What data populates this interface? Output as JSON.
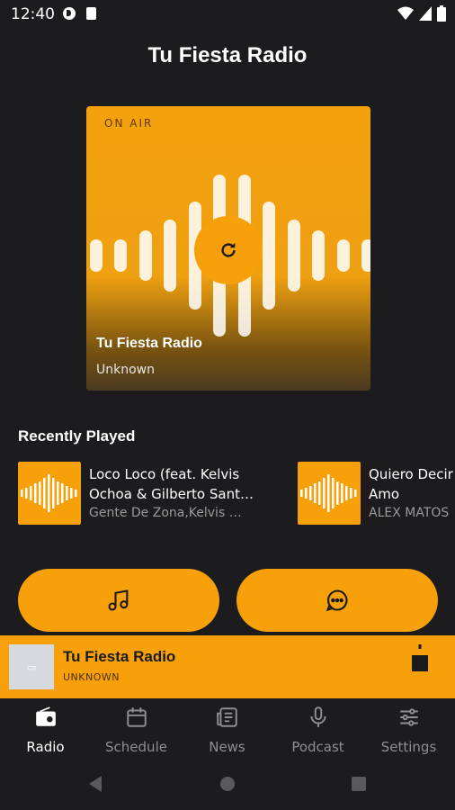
{
  "status_bar": {
    "time": "12:40"
  },
  "app": {
    "title": "Tu Fiesta Radio"
  },
  "now_playing": {
    "badge": "ON AIR",
    "station": "Tu Fiesta Radio",
    "artist": "Unknown"
  },
  "recent": {
    "heading": "Recently Played",
    "items": [
      {
        "title_line1": "Loco Loco (feat. Kelvis",
        "title_line2": "Ochoa & Gilberto Sant…",
        "artist": "Gente De Zona,Kelvis …"
      },
      {
        "title_line1": "Quiero Decir",
        "title_line2": "Amo",
        "artist": "ALEX MATOS"
      }
    ]
  },
  "actions": {
    "left_icon": "music-note-icon",
    "right_icon": "chat-bubble-icon"
  },
  "mini_player": {
    "title": "Tu Fiesta Radio",
    "subtitle": "UNKNOWN",
    "thumb_text": "▭"
  },
  "nav": {
    "items": [
      {
        "label": "Radio",
        "icon": "radio-icon",
        "active": true
      },
      {
        "label": "Schedule",
        "icon": "calendar-icon"
      },
      {
        "label": "News",
        "icon": "newspaper-icon"
      },
      {
        "label": "Podcast",
        "icon": "microphone-icon"
      },
      {
        "label": "Settings",
        "icon": "sliders-icon"
      }
    ]
  },
  "colors": {
    "accent": "#f7a00a",
    "background": "#1c1c1e",
    "muted": "#8e8e93"
  }
}
